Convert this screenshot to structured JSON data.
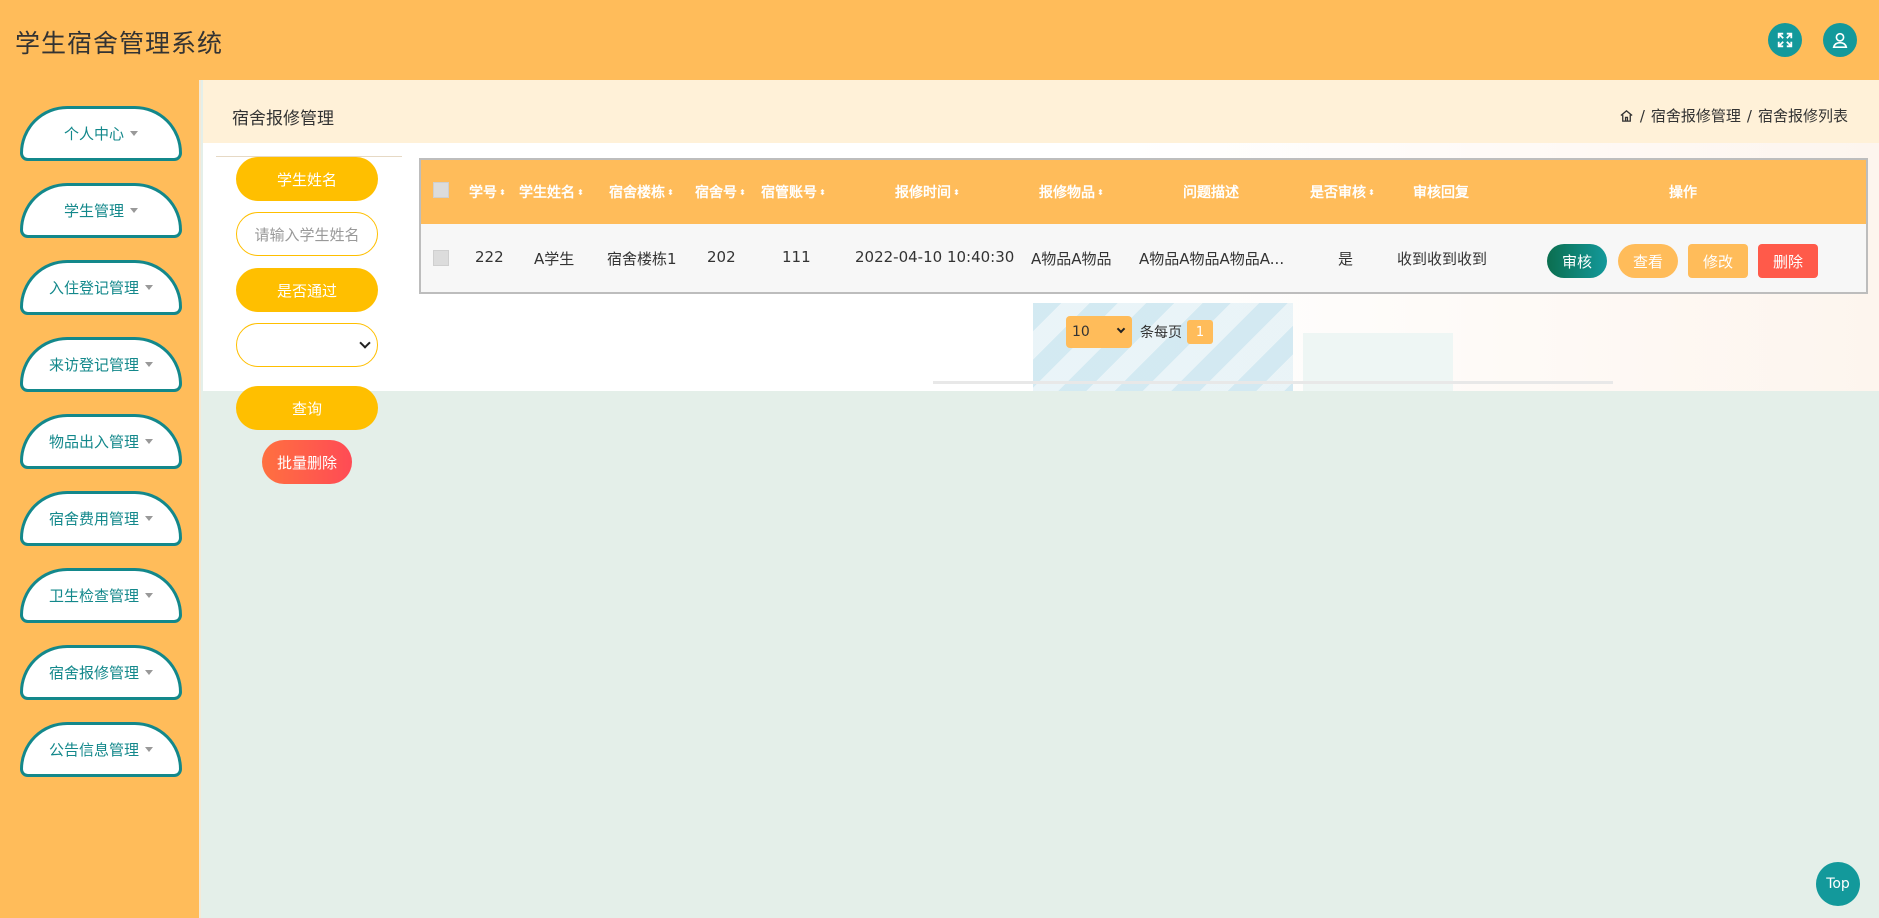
{
  "app": {
    "title": "学生宿舍管理系统"
  },
  "header": {
    "fullscreen_icon": "expand-icon",
    "user_icon": "user-icon"
  },
  "sidebar": {
    "items": [
      {
        "label": "个人中心"
      },
      {
        "label": "学生管理"
      },
      {
        "label": "入住登记管理"
      },
      {
        "label": "来访登记管理"
      },
      {
        "label": "物品出入管理"
      },
      {
        "label": "宿舍费用管理"
      },
      {
        "label": "卫生检查管理"
      },
      {
        "label": "宿舍报修管理"
      },
      {
        "label": "公告信息管理"
      }
    ]
  },
  "page": {
    "title": "宿舍报修管理",
    "breadcrumb": [
      "宿舍报修管理",
      "宿舍报修列表"
    ],
    "breadcrumb_sep": "/"
  },
  "search": {
    "name_label": "学生姓名",
    "name_placeholder": "请输入学生姓名",
    "pass_label": "是否通过",
    "pass_value": "",
    "query_button": "查询",
    "batch_delete_button": "批量删除"
  },
  "table": {
    "columns": [
      "学号",
      "学生姓名",
      "宿舍楼栋",
      "宿舍号",
      "宿管账号",
      "报修时间",
      "报修物品",
      "问题描述",
      "是否审核",
      "审核回复",
      "操作"
    ],
    "rows": [
      {
        "xuehao": "222",
        "name": "A学生",
        "building": "宿舍楼栋1",
        "room": "202",
        "manager": "111",
        "time": "2022-04-10 10:40:30",
        "item": "A物品A物品",
        "desc": "A物品A物品A物品A...",
        "audited": "是",
        "reply": "收到收到收到",
        "actions": [
          "审核",
          "查看",
          "修改",
          "删除"
        ]
      }
    ]
  },
  "pagination": {
    "page_size": "10",
    "per_page_text": "条每页",
    "current_page": "1"
  },
  "top_button": "Top",
  "colors": {
    "primary": "#ffbc5a",
    "teal": "#13999b",
    "amber": "#ffbf00",
    "danger": "#ff4b55"
  }
}
